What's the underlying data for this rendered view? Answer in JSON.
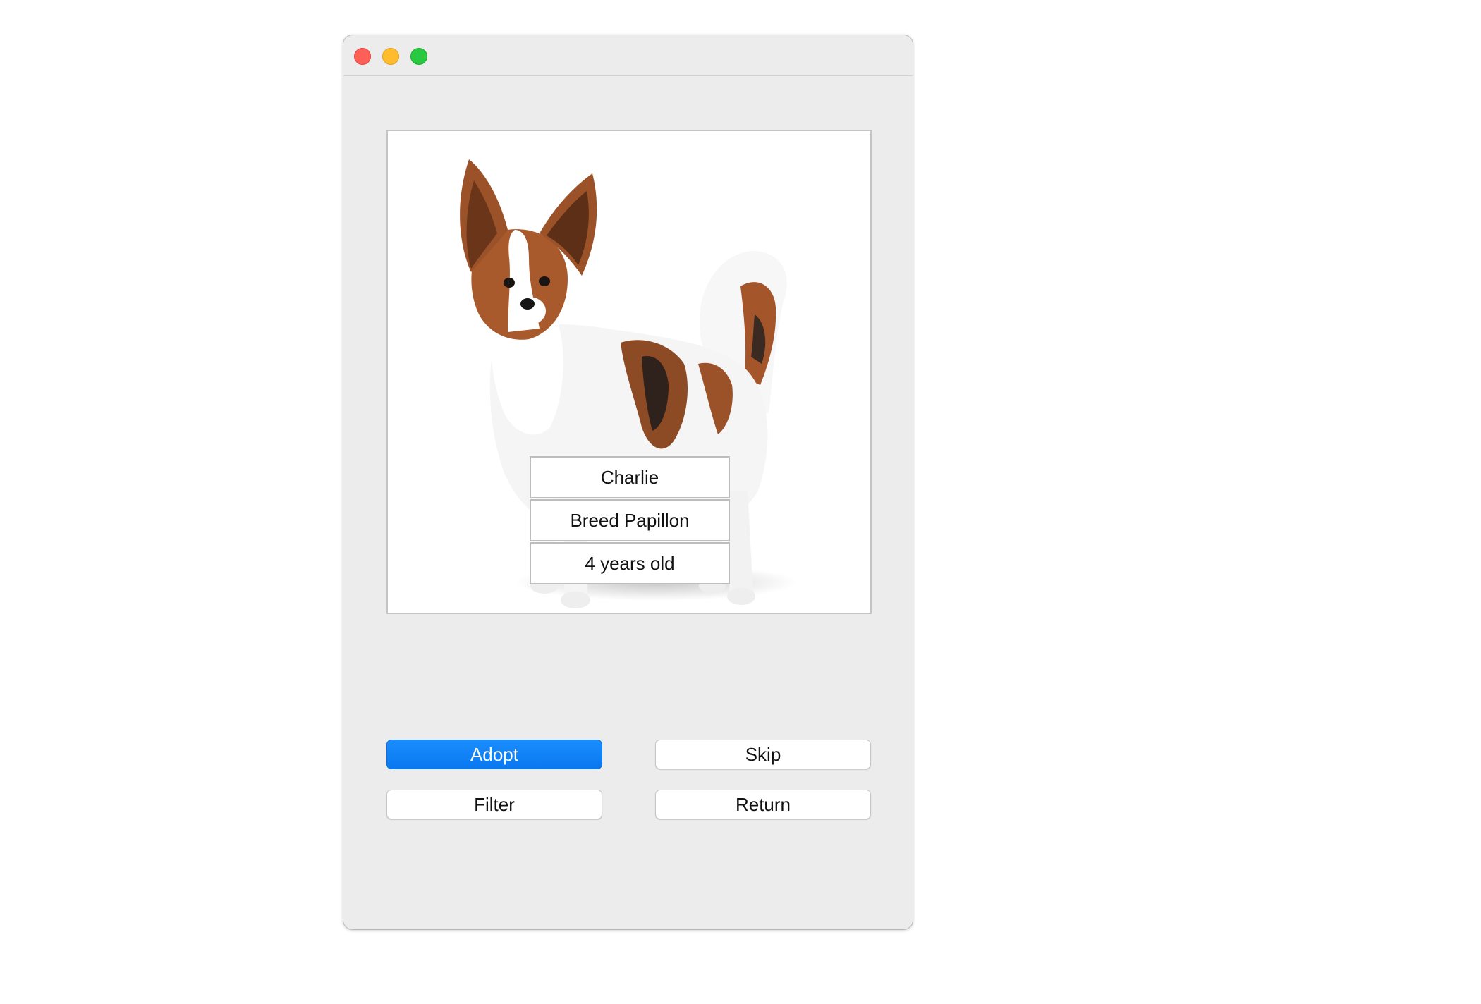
{
  "window": {
    "controls": {
      "close": "close-icon",
      "minimize": "minimize-icon",
      "maximize": "maximize-icon"
    }
  },
  "pet": {
    "photo_icon": "dog-photo",
    "name": "Charlie",
    "breed": "Breed Papillon",
    "age": "4 years old"
  },
  "actions": {
    "adopt_label": "Adopt",
    "skip_label": "Skip",
    "filter_label": "Filter",
    "return_label": "Return"
  },
  "colors": {
    "accent": "#0a84ff",
    "window_bg": "#ececec"
  }
}
